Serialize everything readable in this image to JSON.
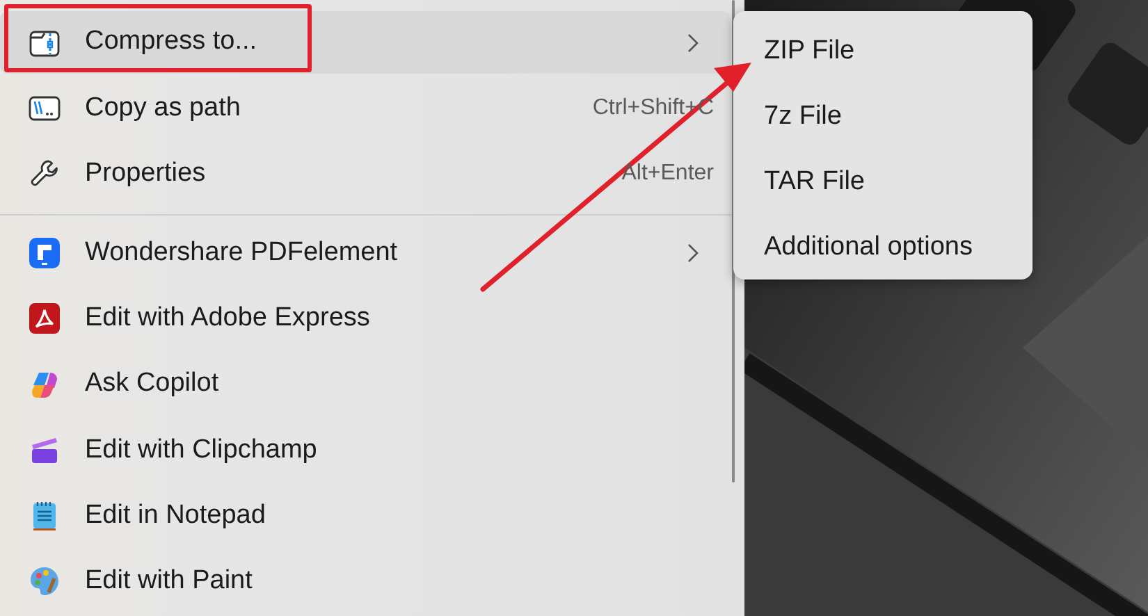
{
  "context_menu": {
    "items": [
      {
        "kind": "item",
        "label": "Compress to...",
        "submenu": true,
        "selected": true
      },
      {
        "kind": "item",
        "label": "Copy as path",
        "shortcut": "Ctrl+Shift+C",
        "submenu": false,
        "selected": false
      },
      {
        "kind": "item",
        "label": "Properties",
        "shortcut": "Alt+Enter",
        "submenu": false,
        "selected": false
      },
      {
        "kind": "separator"
      },
      {
        "kind": "item",
        "label": "Wondershare PDFelement",
        "submenu": true,
        "selected": false
      },
      {
        "kind": "item",
        "label": "Edit with Adobe Express",
        "submenu": false,
        "selected": false
      },
      {
        "kind": "item",
        "label": "Ask Copilot",
        "submenu": false,
        "selected": false
      },
      {
        "kind": "item",
        "label": "Edit with Clipchamp",
        "submenu": false,
        "selected": false
      },
      {
        "kind": "item",
        "label": "Edit in Notepad",
        "submenu": false,
        "selected": false
      },
      {
        "kind": "item",
        "label": "Edit with Paint",
        "submenu": false,
        "selected": false
      }
    ]
  },
  "submenu": {
    "items": [
      {
        "label": "ZIP File"
      },
      {
        "label": "7z File"
      },
      {
        "label": "TAR File"
      },
      {
        "label": "Additional options"
      }
    ]
  }
}
